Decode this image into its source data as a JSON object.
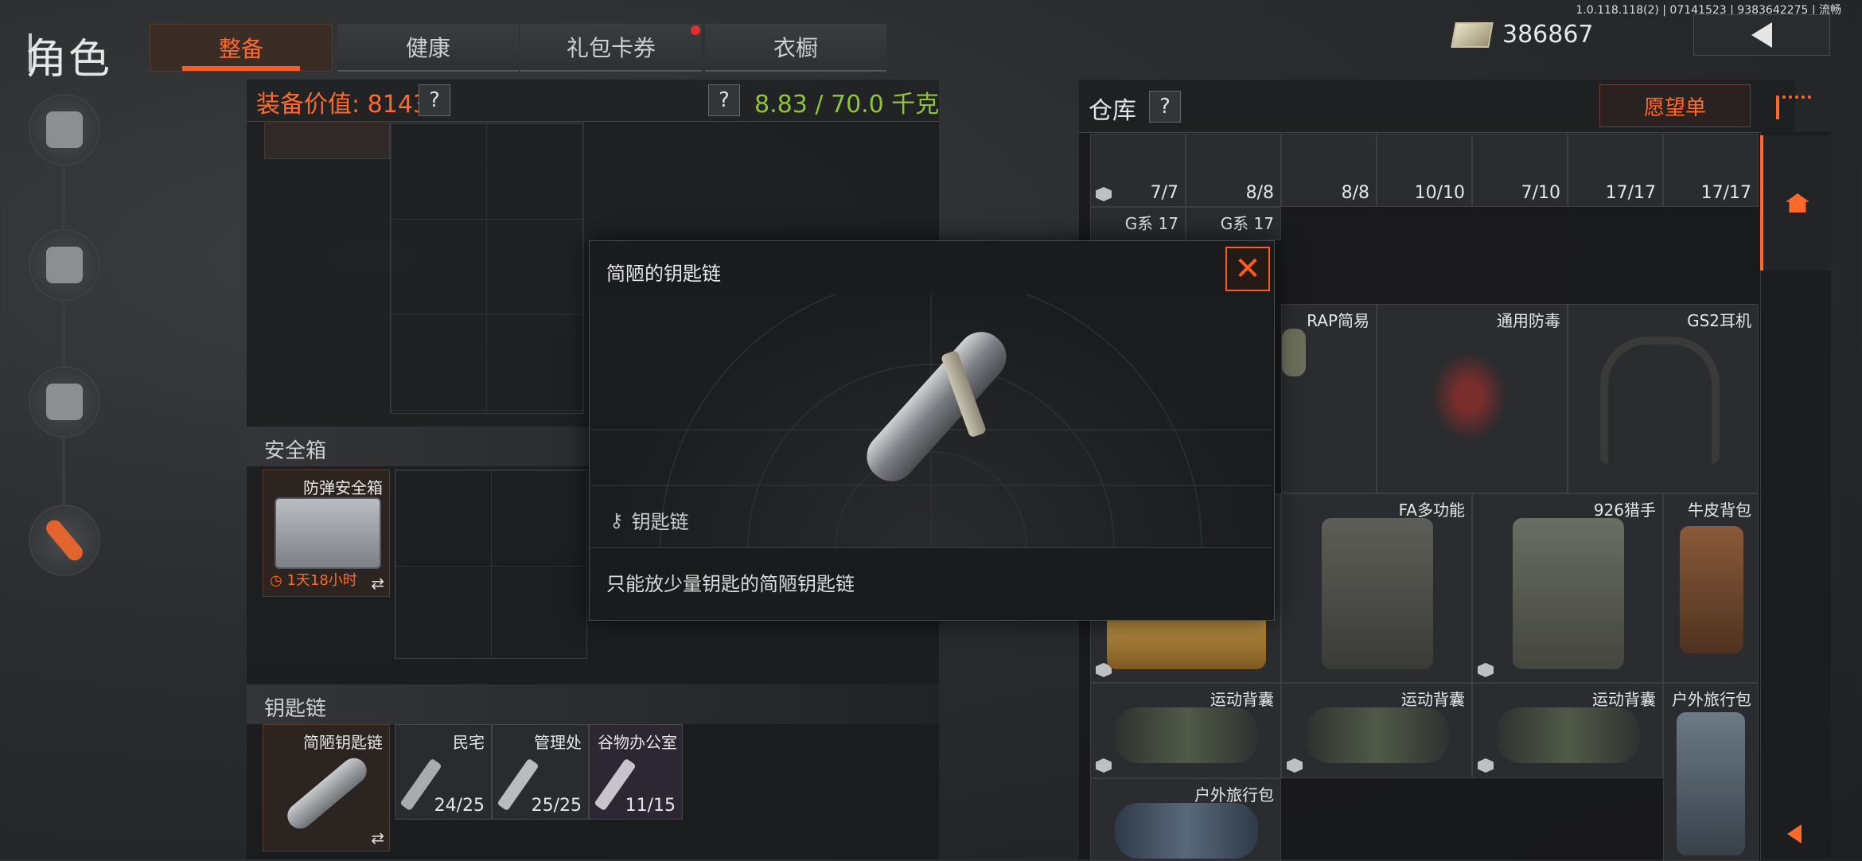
{
  "header": {
    "title": "角色",
    "tabs": [
      {
        "label": "整备",
        "active": true
      },
      {
        "label": "健康",
        "active": false
      },
      {
        "label": "礼包卡券",
        "active": false,
        "badge": true
      },
      {
        "label": "衣橱",
        "active": false
      }
    ],
    "money": "386867",
    "version": "1.0.118.118(2) | 07141523 | 9383642275 | 流畅"
  },
  "sidebar": {
    "items": [
      {
        "icon": "weapon-helmet-icon",
        "active": false
      },
      {
        "icon": "vest-icon",
        "active": false
      },
      {
        "icon": "mask-icon",
        "active": false
      },
      {
        "icon": "tool-icon",
        "active": true
      }
    ]
  },
  "equipment": {
    "value_label": "装备价值: 8143",
    "help": "?",
    "weight": "8.83 / 70.0 千克",
    "safebox_section": "安全箱",
    "safebox_item": {
      "name": "防弹安全箱",
      "timer": "1天18小时"
    },
    "keychain_section": "钥匙链",
    "keychain_item": {
      "name": "简陋钥匙链"
    },
    "keys": [
      {
        "name": "民宅",
        "count": "24/25"
      },
      {
        "name": "管理处",
        "count": "25/25"
      },
      {
        "name": "谷物办公室",
        "count": "11/15"
      }
    ]
  },
  "storage": {
    "title": "仓库",
    "help": "?",
    "wishlist": "愿望单",
    "mag_counts": [
      "7/7",
      "8/8",
      "8/8",
      "10/10",
      "7/10",
      "17/17",
      "17/17"
    ],
    "mag_names": [
      "G系 17",
      "G系 17"
    ],
    "items": [
      {
        "name": "RAP简易"
      },
      {
        "name": "通用防毒"
      },
      {
        "name": "GS2耳机"
      },
      {
        "name": "FA多功能"
      },
      {
        "name": "926猎手"
      },
      {
        "name": "牛皮背包"
      },
      {
        "name": "运动背囊"
      },
      {
        "name": "运动背囊"
      },
      {
        "name": "运动背囊"
      },
      {
        "name": "户外旅行包"
      },
      {
        "name": "户外旅行包"
      }
    ]
  },
  "modal": {
    "title": "简陋的钥匙链",
    "close": "✕",
    "type_label": "钥匙链",
    "description": "只能放少量钥匙的简陋钥匙链"
  },
  "colors": {
    "accent": "#ff6a2a",
    "weight": "#8fc43a"
  }
}
